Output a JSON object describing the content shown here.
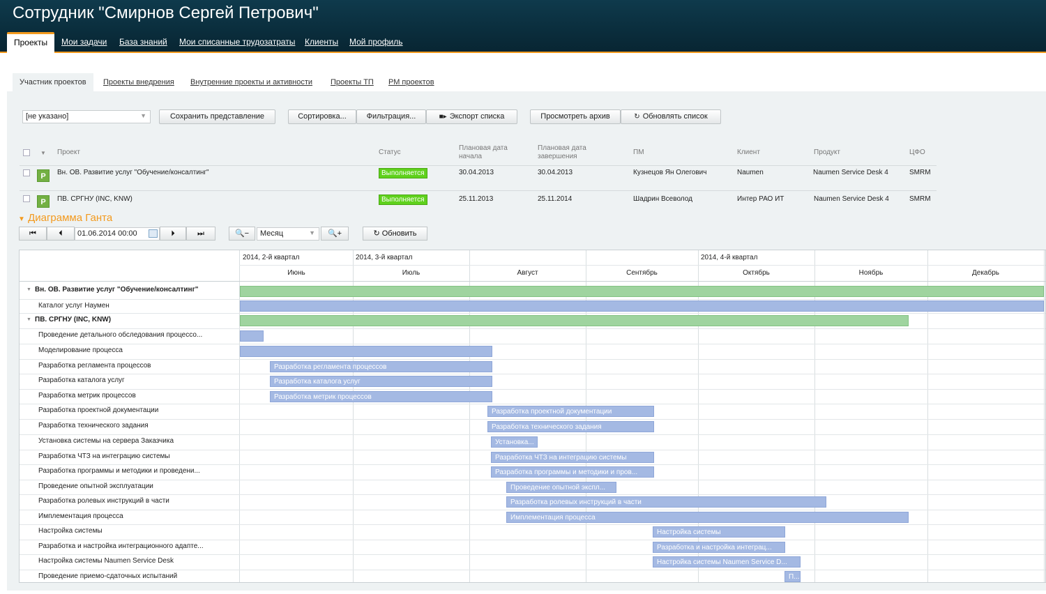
{
  "header": {
    "title": "Сотрудник \"Смирнов Сергей Петрович\"",
    "tabs": [
      "Проекты",
      "Мои задачи",
      "База знаний",
      "Мои списанные трудозатраты",
      "Клиенты",
      "Мой профиль"
    ]
  },
  "subtabs": [
    "Участник проектов",
    "Проекты внедрения",
    "Внутренние проекты и активности",
    "Проекты ТП",
    "РМ проектов"
  ],
  "toolbar": {
    "view_select": "[не указано]",
    "save_view": "Сохранить представление",
    "sort": "Сортировка...",
    "filter": "Фильтрация...",
    "export": "Экспорт списка",
    "archive": "Просмотреть архив",
    "refresh_list": "Обновлять список"
  },
  "projects_table": {
    "columns": {
      "project": "Проект",
      "status": "Статус",
      "plan_start_1": "Плановая дата",
      "plan_start_2": "начала",
      "plan_end_1": "Плановая дата",
      "plan_end_2": "завершения",
      "pm": "ПМ",
      "client": "Клиент",
      "product": "Продукт",
      "cfo": "ЦФО"
    },
    "rows": [
      {
        "icon": "P",
        "project": "Вн. ОВ. Развитие услуг \"Обучение/консалтинг\"",
        "status": "Выполняется",
        "start": "30.04.2013",
        "end": "30.04.2013",
        "pm": "Кузнецов Ян Олегович",
        "client": "Naumen",
        "product": "Naumen Service Desk 4",
        "cfo": "SMRM"
      },
      {
        "icon": "P",
        "project": "ПВ. СРГНУ (INC, KNW)",
        "status": "Выполняется",
        "start": "25.11.2013",
        "end": "25.11.2014",
        "pm": "Шадрин Всеволод",
        "client": "Интер РАО ИТ",
        "product": "Naumen Service Desk 4",
        "cfo": "SMRM"
      }
    ]
  },
  "gantt": {
    "title": "Диаграмма Ганта",
    "date": "01.06.2014 00:00",
    "scale": "Месяц",
    "refresh": "Обновить",
    "quarters": [
      "2014, 2-й квартал",
      "2014, 3-й квартал",
      "2014, 4-й квартал"
    ],
    "months": [
      "Июнь",
      "Июль",
      "Август",
      "Сентябрь",
      "Октябрь",
      "Ноябрь",
      "Декабрь"
    ],
    "rows": [
      {
        "label": "Вн. ОВ. Развитие услуг \"Обучение/консалтинг\"",
        "group": true,
        "bar": ""
      },
      {
        "label": "Каталог услуг Наумен",
        "group": false,
        "bar": ""
      },
      {
        "label": "ПВ. СРГНУ (INC, KNW)",
        "group": true,
        "bar": ""
      },
      {
        "label": "Проведение детального обследования процессо...",
        "group": false,
        "bar": ""
      },
      {
        "label": "Моделирование процесса",
        "group": false,
        "bar": ""
      },
      {
        "label": "Разработка регламента процессов",
        "group": false,
        "bar": "Разработка регламента процессов"
      },
      {
        "label": "Разработка каталога услуг",
        "group": false,
        "bar": "Разработка каталога услуг"
      },
      {
        "label": "Разработка метрик процессов",
        "group": false,
        "bar": "Разработка метрик процессов"
      },
      {
        "label": "Разработка проектной документации",
        "group": false,
        "bar": "Разработка проектной документации"
      },
      {
        "label": "Разработка технического задания",
        "group": false,
        "bar": "Разработка технического задания"
      },
      {
        "label": "Установка системы на сервера Заказчика",
        "group": false,
        "bar": "Установка..."
      },
      {
        "label": "Разработка ЧТЗ на интеграцию системы",
        "group": false,
        "bar": "Разработка ЧТЗ на интеграцию системы"
      },
      {
        "label": "Разработка программы и методики и проведени...",
        "group": false,
        "bar": "Разработка программы и методики и пров..."
      },
      {
        "label": "Проведение опытной эксплуатации",
        "group": false,
        "bar": "Проведение опытной экспл..."
      },
      {
        "label": "Разработка ролевых инструкций в части",
        "group": false,
        "bar": "Разработка ролевых инструкций в части"
      },
      {
        "label": "Имплементация процесса",
        "group": false,
        "bar": "Имплементация процесса"
      },
      {
        "label": "Настройка системы",
        "group": false,
        "bar": "Настройка системы"
      },
      {
        "label": "Разработка и настройка интеграционного адапте...",
        "group": false,
        "bar": "Разработка и настройка интеграц..."
      },
      {
        "label": "Настройка системы Naumen Service Desk",
        "group": false,
        "bar": "Настройка системы Naumen Service D..."
      },
      {
        "label": "Проведение приемо-сдаточных испытаний",
        "group": false,
        "bar": "П..."
      }
    ]
  }
}
